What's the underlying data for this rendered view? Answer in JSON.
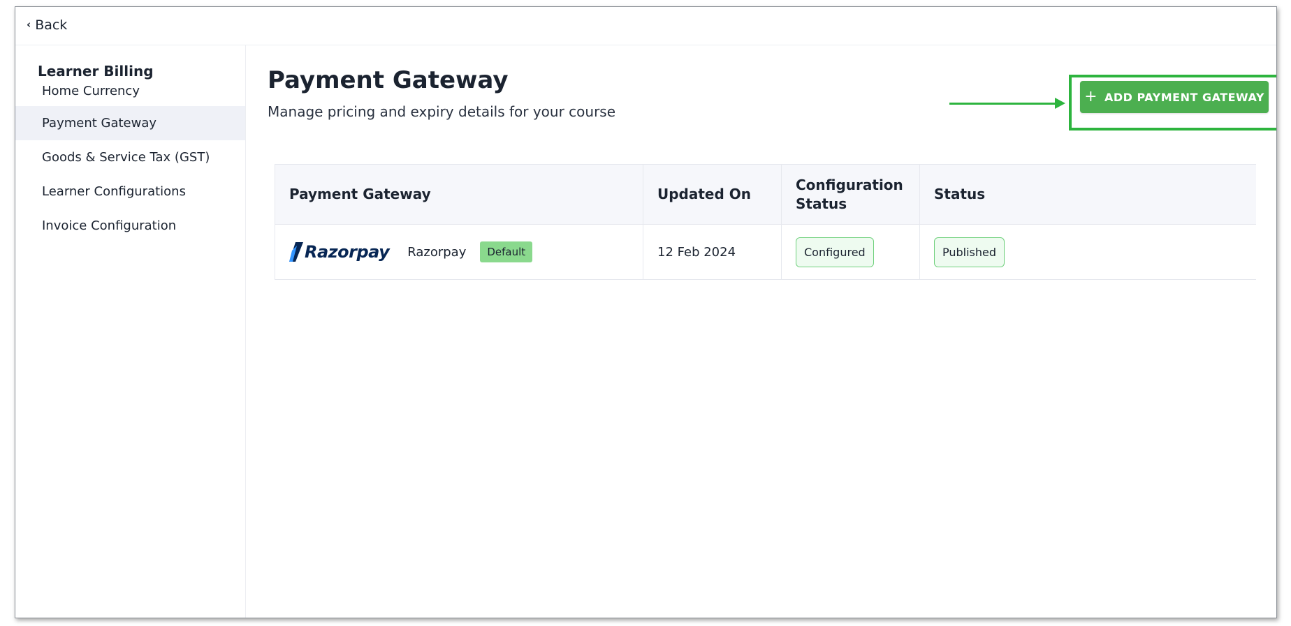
{
  "topbar": {
    "back_label": "Back"
  },
  "sidebar": {
    "title": "Learner Billing",
    "items": [
      {
        "label": "Home Currency",
        "active": false
      },
      {
        "label": "Payment Gateway",
        "active": true
      },
      {
        "label": "Goods & Service Tax (GST)",
        "active": false
      },
      {
        "label": "Learner Configurations",
        "active": false
      },
      {
        "label": "Invoice Configuration",
        "active": false
      }
    ]
  },
  "main": {
    "title": "Payment Gateway",
    "subtitle": "Manage pricing and expiry details for your course",
    "add_button_label": "ADD PAYMENT GATEWAY",
    "table": {
      "headers": [
        "Payment Gateway",
        "Updated On",
        "Configuration Status",
        "Status"
      ],
      "rows": [
        {
          "logo_text": "Razorpay",
          "name": "Razorpay",
          "badge": "Default",
          "updated_on": "12 Feb 2024",
          "configuration_status": "Configured",
          "status": "Published"
        }
      ]
    }
  },
  "colors": {
    "accent_green": "#4caf50",
    "highlight_green": "#2db43e",
    "razorpay_navy": "#072654",
    "razorpay_blue": "#3395ff"
  },
  "icons": {
    "back": "chevron-left-icon",
    "add": "plus-icon",
    "annotation": "arrow-right-icon"
  }
}
